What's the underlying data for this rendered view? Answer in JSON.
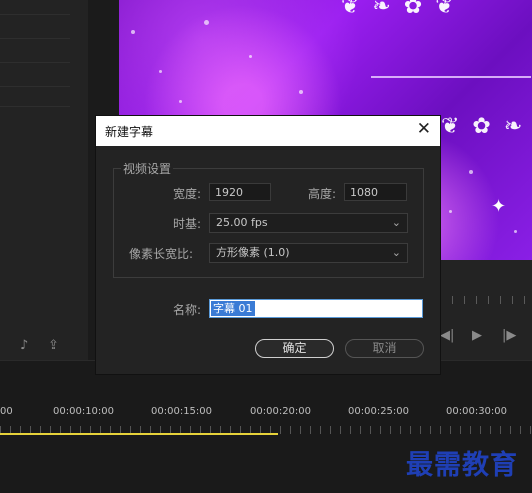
{
  "dialog": {
    "title": "新建字幕",
    "close_glyph": "✕",
    "video_settings": {
      "group_title": "视频设置",
      "width_label": "宽度:",
      "width_value": "1920",
      "height_label": "高度:",
      "height_value": "1080",
      "timebase_label": "时基:",
      "timebase_value": "25.00 fps",
      "pixel_aspect_label": "像素长宽比:",
      "pixel_aspect_value": "方形像素 (1.0)"
    },
    "name_label": "名称:",
    "name_value": "字幕 01",
    "ok_label": "确定",
    "cancel_label": "取消"
  },
  "timeline": {
    "timecodes": [
      "00",
      "00:00:10:00",
      "00:00:15:00",
      "00:00:20:00",
      "00:00:25:00",
      "00:00:30:00"
    ]
  },
  "watermark": "最需教育",
  "icons": {
    "dropdown": "chevron-down-icon",
    "close": "close-icon"
  },
  "colors": {
    "dialog_bg": "#232323",
    "titlebar_bg": "#ffffff",
    "selection": "#3a7bd5",
    "work_area": "#e6d23a",
    "watermark": "#1f3fb5",
    "monitor_purple": "#8a1fe6"
  }
}
